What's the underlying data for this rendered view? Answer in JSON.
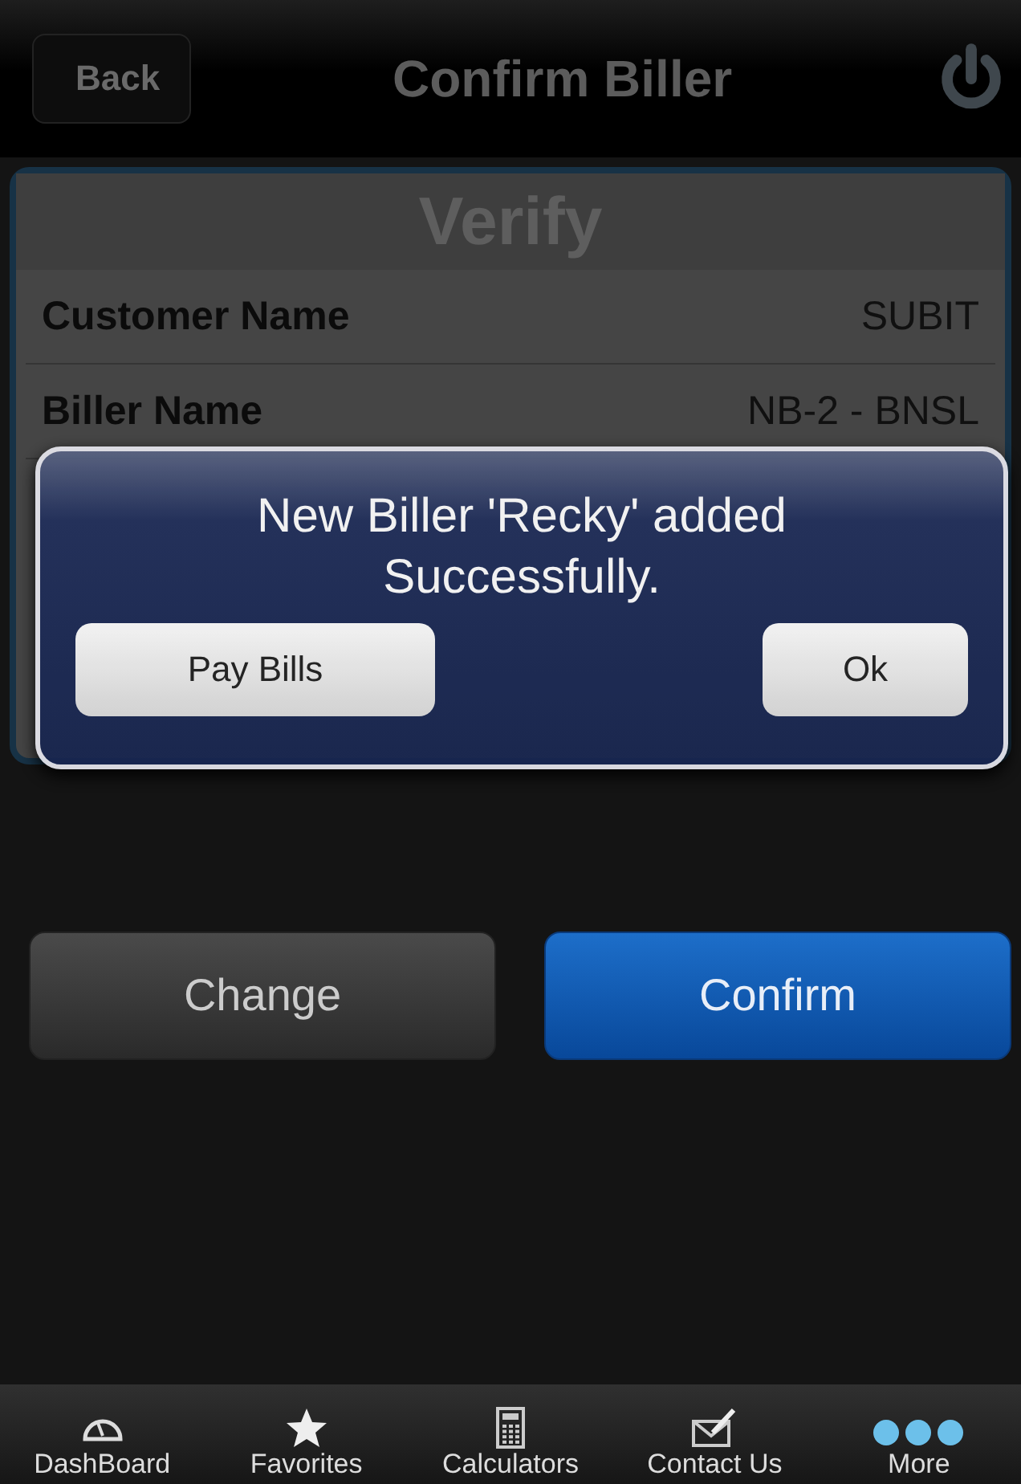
{
  "nav_bar": {
    "back": "Back",
    "title": "Confirm Biller"
  },
  "card": {
    "title": "Verify",
    "rows": [
      {
        "label": "Customer Name",
        "value": "SUBIT"
      },
      {
        "label": "Biller Name",
        "value": "NB-2 - BNSL"
      }
    ]
  },
  "alert": {
    "message": "New Biller 'Recky' added Successfully.",
    "buttons": [
      "Pay Bills",
      "Ok"
    ]
  },
  "actions": [
    {
      "label": "Change",
      "kind": "secondary"
    },
    {
      "label": "Confirm",
      "kind": "primary"
    }
  ],
  "tab_bar": [
    {
      "label": "DashBoard"
    },
    {
      "label": "Favorites"
    },
    {
      "label": "Calculators"
    },
    {
      "label": "Contact Us"
    },
    {
      "label": "More"
    }
  ]
}
